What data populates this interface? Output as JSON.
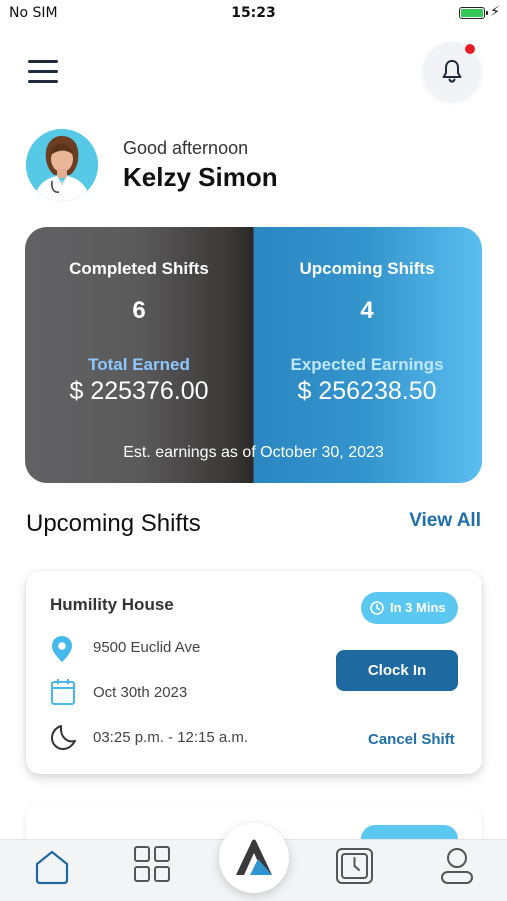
{
  "status_bar": {
    "carrier": "No SIM",
    "time": "15:23",
    "battery_level": 1.0,
    "bolt": "⚡"
  },
  "header": {
    "menu_icon": "hamburger-menu-icon",
    "notification_icon": "bell-icon",
    "has_unread": true,
    "accent_color": "#e51e25"
  },
  "profile": {
    "greeting": "Good afternoon",
    "name": "Kelzy Simon"
  },
  "summary": {
    "completed": {
      "title": "Completed Shifts",
      "count": "6",
      "earnings_label": "Total Earned",
      "earnings_value": "$ 225376.00"
    },
    "upcoming": {
      "title": "Upcoming Shifts",
      "count": "4",
      "earnings_label": "Expected Earnings",
      "earnings_value": "$ 256238.50"
    },
    "footer": "Est. earnings as of October 30, 2023"
  },
  "upcoming_section": {
    "title": "Upcoming Shifts",
    "view_all": "View All"
  },
  "shifts": [
    {
      "facility": "Humility House",
      "badge": "In 3 Mins",
      "address": "9500 Euclid Ave",
      "date": "Oct 30th 2023",
      "time_range": "03:25 p.m. - 12:15 a.m.",
      "clock_in_label": "Clock In",
      "cancel_label": "Cancel Shift"
    }
  ],
  "bottom_nav": {
    "items": [
      "home-icon",
      "grid-icon",
      "app-logo-icon",
      "timesheet-icon",
      "profile-icon"
    ],
    "active": "home-icon"
  },
  "colors": {
    "brand_blue": "#1e6aa0",
    "badge_blue": "#5bc8f2",
    "link_blue": "#1f6fa8"
  }
}
